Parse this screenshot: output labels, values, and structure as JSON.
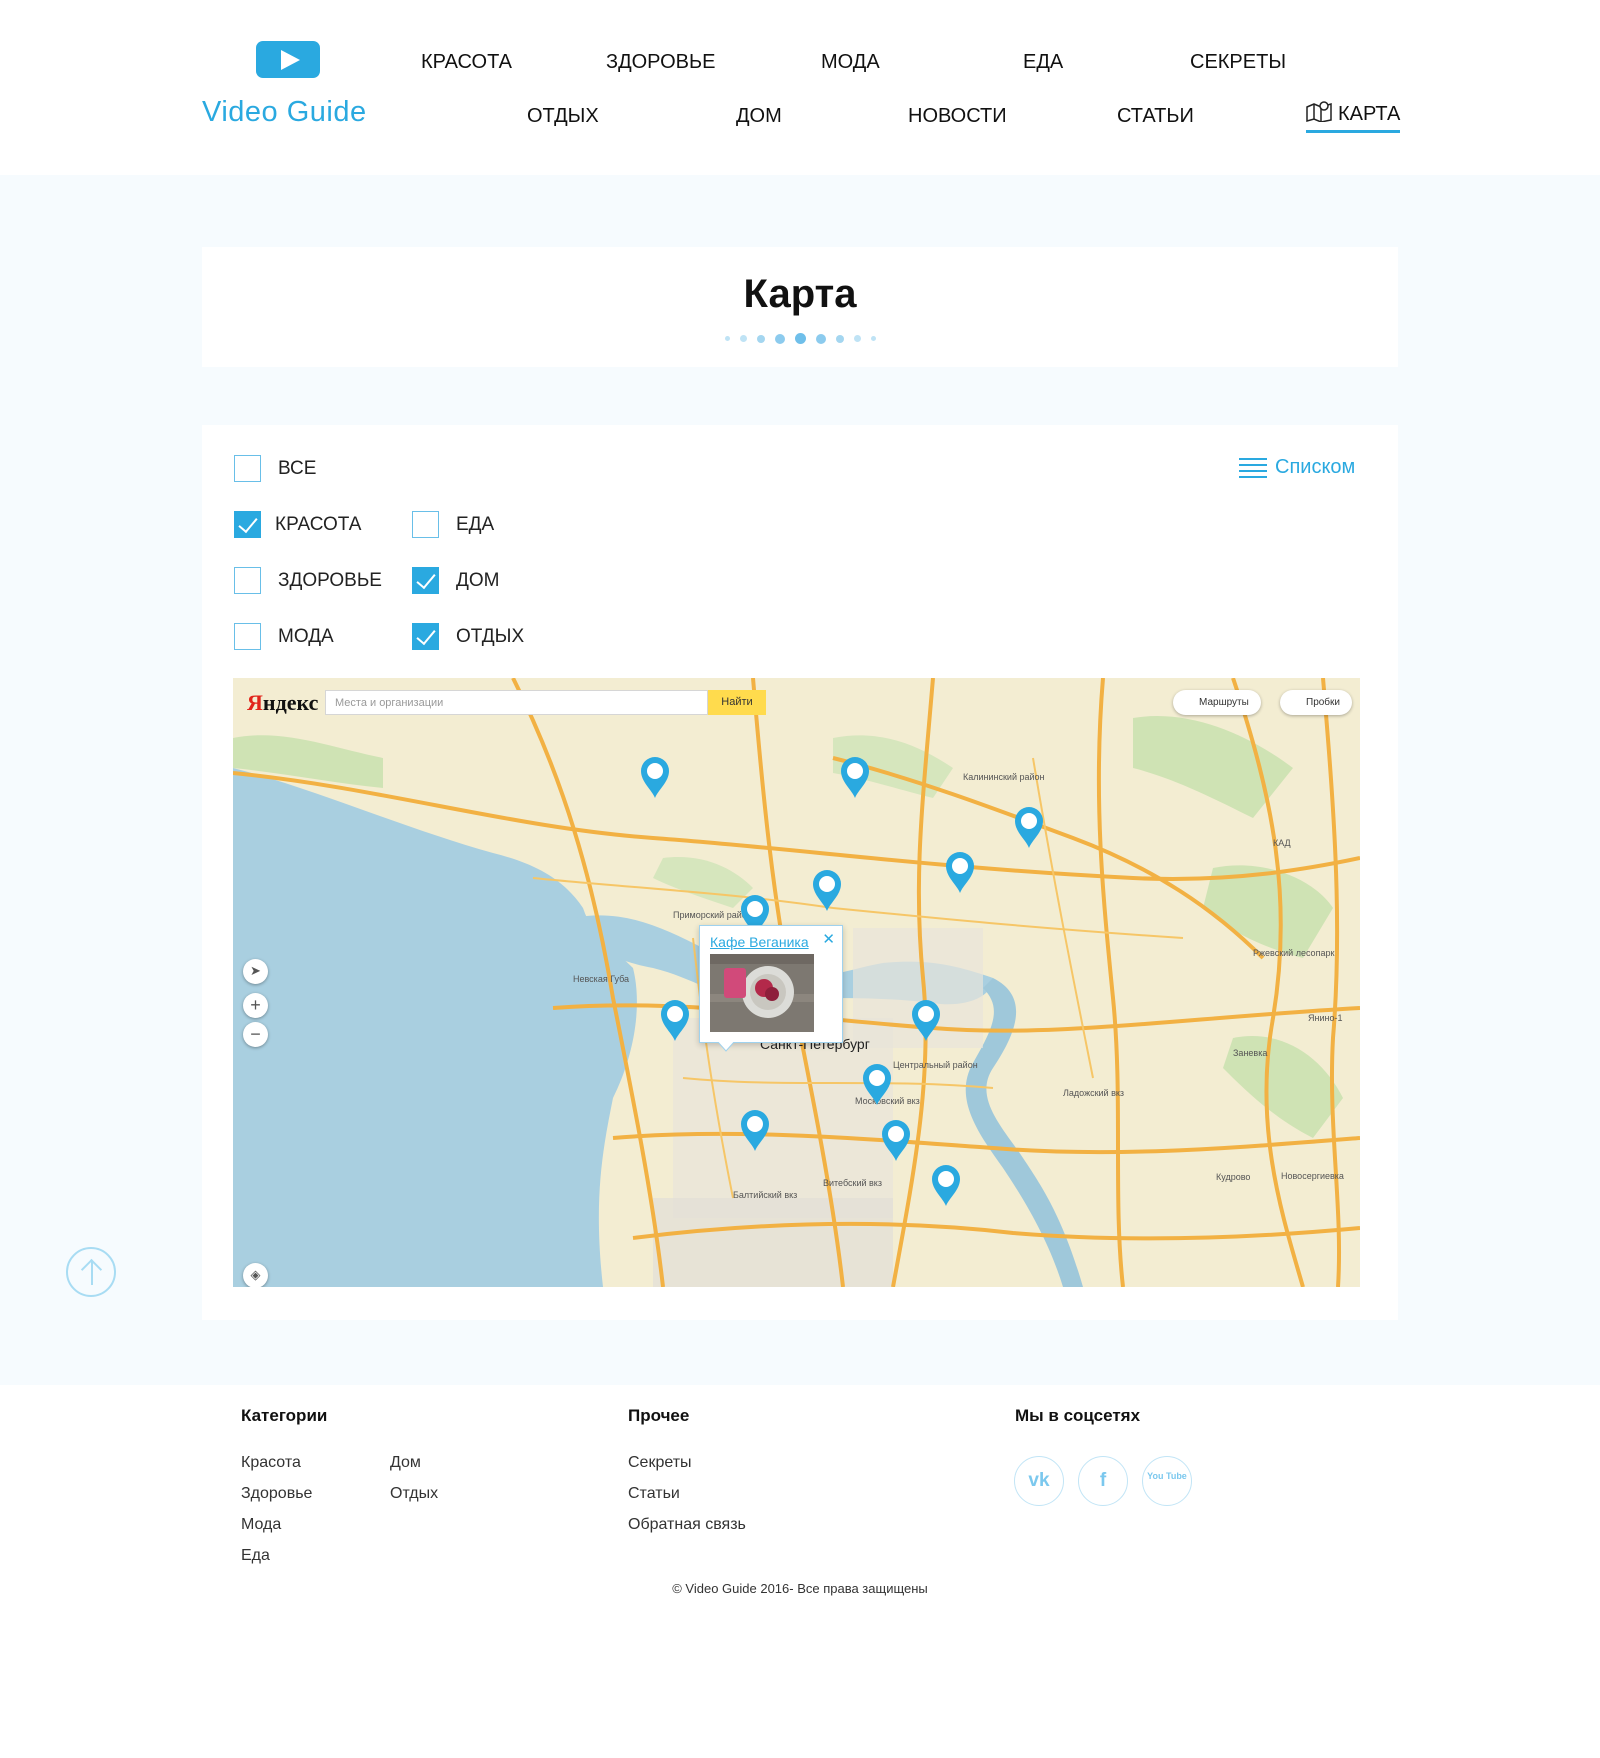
{
  "header": {
    "logo_text": "Video Guide",
    "nav_top": [
      "Красота",
      "Здоровье",
      "Мода",
      "Еда",
      "Секреты"
    ],
    "nav_bottom": [
      "Отдых",
      "Дом",
      "Новости",
      "Статьи",
      "Карта"
    ],
    "active_item": "Карта"
  },
  "page": {
    "title": "Карта"
  },
  "filters": {
    "all_label": "Все",
    "items": [
      {
        "label": "Красота",
        "checked": true
      },
      {
        "label": "Здоровье",
        "checked": false
      },
      {
        "label": "Мода",
        "checked": false
      },
      {
        "label": "Еда",
        "checked": false
      },
      {
        "label": "Дом",
        "checked": true
      },
      {
        "label": "Отдых",
        "checked": true
      }
    ],
    "list_view_label": "Списком"
  },
  "map": {
    "provider_logo_red": "Я",
    "provider_logo_rest": "ндекс",
    "search_placeholder": "Места и организации",
    "search_button": "Найти",
    "routes_button": "Маршруты",
    "traffic_button": "Пробки",
    "city_label": "Санкт-Петербург",
    "popup_title": "Кафе Веганика",
    "small_labels": [
      "Приморский район",
      "Калининский район",
      "Центральный район",
      "Невская Губа",
      "Ржевский лесопарк",
      "Заневка",
      "Кудрово",
      "Новосергиевка",
      "Янино-1",
      "КАД",
      "Московский вкз",
      "Балтийский вкз",
      "Витебский вкз",
      "Ладожский вкз"
    ],
    "accent_color": "#2aa9e0"
  },
  "footer": {
    "categories_title": "Категории",
    "categories_col1": [
      "Красота",
      "Здоровье",
      "Мода",
      "Еда"
    ],
    "categories_col2": [
      "Дом",
      "Отдых"
    ],
    "other_title": "Прочее",
    "other_links": [
      "Секреты",
      "Статьи",
      "Обратная связь"
    ],
    "social_title": "Мы в соцсетях",
    "social": [
      {
        "icon": "vk-icon",
        "text": "vk"
      },
      {
        "icon": "facebook-icon",
        "text": "f"
      },
      {
        "icon": "youtube-icon",
        "text": "You Tube"
      }
    ],
    "copyright": "© Video Guide  2016- Все права защищены"
  }
}
